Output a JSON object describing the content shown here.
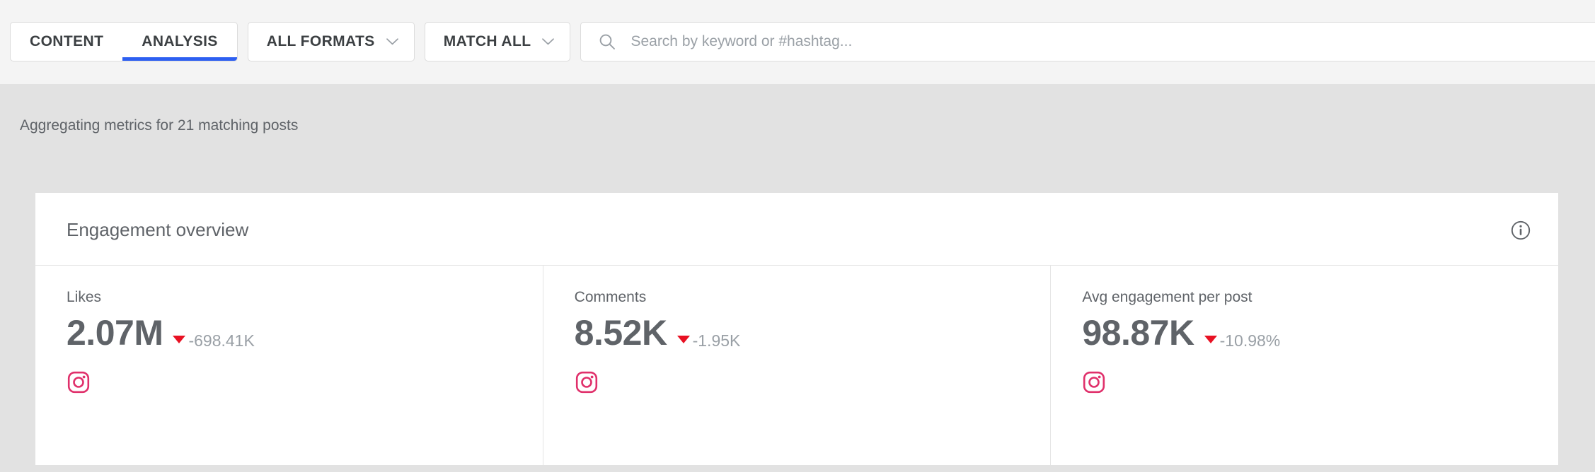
{
  "toolbar": {
    "tabs": [
      {
        "label": "CONTENT",
        "active": false,
        "name": "tab-content"
      },
      {
        "label": "ANALYSIS",
        "active": true,
        "name": "tab-analysis"
      }
    ],
    "active_tab_underline_color": "#2d5ff1",
    "filters": [
      {
        "label": "ALL FORMATS",
        "icon": "chevron-down-icon"
      },
      {
        "label": "MATCH ALL",
        "icon": "chevron-down-icon"
      }
    ],
    "search": {
      "icon": "search-icon",
      "placeholder": "Search by keyword or #hashtag...",
      "value": ""
    }
  },
  "status": {
    "text": "Aggregating metrics for 21 matching posts"
  },
  "card": {
    "title": "Engagement overview",
    "info_icon": "info-circle-icon",
    "metrics": [
      {
        "label": "Likes",
        "value": "2.07M",
        "delta": "-698.41K",
        "delta_direction": "down",
        "delta_color": "#e81123",
        "network": "instagram-icon",
        "network_color": "#e0306b"
      },
      {
        "label": "Comments",
        "value": "8.52K",
        "delta": "-1.95K",
        "delta_direction": "down",
        "delta_color": "#e81123",
        "network": "instagram-icon",
        "network_color": "#e0306b"
      },
      {
        "label": "Avg engagement per post",
        "value": "98.87K",
        "delta": "-10.98%",
        "delta_direction": "down",
        "delta_color": "#e81123",
        "network": "instagram-icon",
        "network_color": "#e0306b"
      }
    ]
  }
}
